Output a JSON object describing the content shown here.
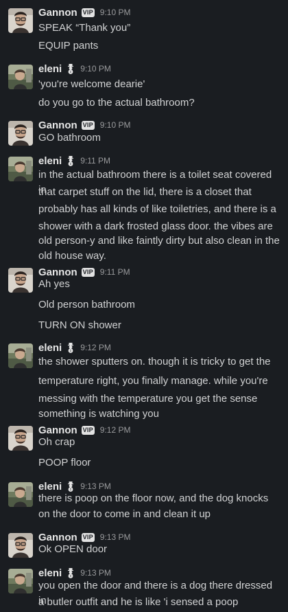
{
  "users": {
    "gannon": {
      "name": "Gannon",
      "badge": "VIP"
    },
    "eleni": {
      "name": "eleni",
      "badge_icon": "snowman-icon"
    }
  },
  "messages": [
    {
      "author": "Gannon",
      "time": "9:10 PM",
      "lines": [
        "SPEAK “Thank you”",
        "EQUIP pants"
      ]
    },
    {
      "author": "eleni",
      "time": "9:10 PM",
      "lines": [
        "'you're welcome dearie'",
        "do you go to the actual bathroom?"
      ]
    },
    {
      "author": "Gannon",
      "time": "9:10 PM",
      "lines": [
        "GO bathroom"
      ]
    },
    {
      "author": "eleni",
      "time": "9:11 PM",
      "lines": [
        "in the actual bathroom there is a toilet seat covered in",
        "that carpet stuff on the lid, there is a closet that",
        "probably has all kinds of like toiletries, and there is a",
        "shower with a dark frosted glass door. the vibes are",
        "old person-y and like faintly dirty but also clean in the",
        "old house way."
      ]
    },
    {
      "author": "Gannon",
      "time": "9:11 PM",
      "lines": [
        "Ah yes",
        "Old person bathroom",
        "TURN ON shower"
      ]
    },
    {
      "author": "eleni",
      "time": "9:12 PM",
      "lines": [
        "the shower sputters on. though it is tricky to get the",
        "temperature right, you finally manage. while you're",
        "messing with the temperature you get the sense",
        "something is watching you"
      ]
    },
    {
      "author": "Gannon",
      "time": "9:12 PM",
      "lines": [
        "Oh crap",
        "POOP floor"
      ]
    },
    {
      "author": "eleni",
      "time": "9:13 PM",
      "lines": [
        "there is poop on the floor now, and the dog knocks",
        "on the door to come in and clean it up"
      ]
    },
    {
      "author": "Gannon",
      "time": "9:13 PM",
      "lines": [
        "Ok OPEN door"
      ]
    },
    {
      "author": "eleni",
      "time": "9:13 PM",
      "lines": [
        "you open the door and there is a dog there dressed in",
        "a butler outfit and he is like 'i sensed a poop"
      ]
    }
  ]
}
